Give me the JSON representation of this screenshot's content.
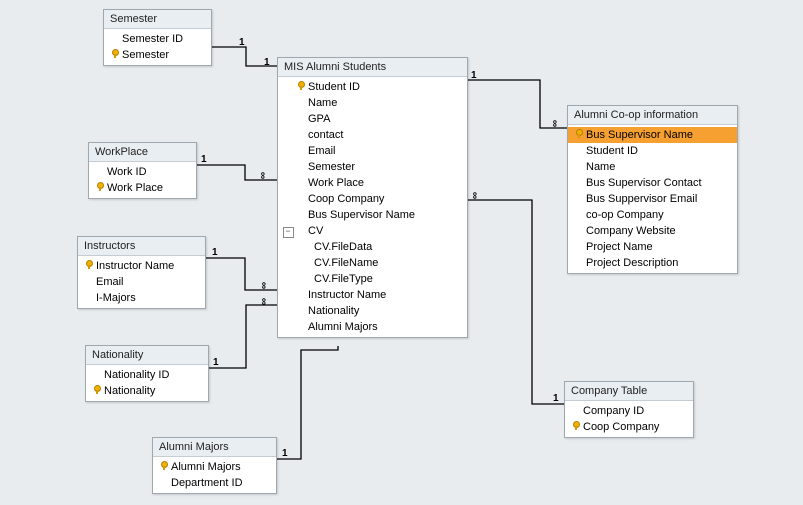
{
  "entities": {
    "semester": {
      "title": "Semester",
      "fields": [
        {
          "key": false,
          "label": "Semester ID"
        },
        {
          "key": true,
          "label": "Semester"
        }
      ]
    },
    "workplace": {
      "title": "WorkPlace",
      "fields": [
        {
          "key": false,
          "label": "Work ID"
        },
        {
          "key": true,
          "label": "Work Place"
        }
      ]
    },
    "instructors": {
      "title": "Instructors",
      "fields": [
        {
          "key": true,
          "label": "Instructor Name"
        },
        {
          "key": false,
          "label": "Email"
        },
        {
          "key": false,
          "label": "I-Majors"
        }
      ]
    },
    "nationality": {
      "title": "Nationality",
      "fields": [
        {
          "key": false,
          "label": "Nationality ID"
        },
        {
          "key": true,
          "label": "Nationality"
        }
      ]
    },
    "alumni_majors": {
      "title": "Alumni Majors",
      "fields": [
        {
          "key": true,
          "label": "Alumni Majors"
        },
        {
          "key": false,
          "label": "Department ID"
        }
      ]
    },
    "mis": {
      "title": "MIS Alumni Students",
      "fields": [
        {
          "key": true,
          "label": "Student ID"
        },
        {
          "key": false,
          "label": "Name"
        },
        {
          "key": false,
          "label": "GPA"
        },
        {
          "key": false,
          "label": "contact"
        },
        {
          "key": false,
          "label": "Email"
        },
        {
          "key": false,
          "label": "Semester"
        },
        {
          "key": false,
          "label": "Work Place"
        },
        {
          "key": false,
          "label": "Coop Company"
        },
        {
          "key": false,
          "label": "Bus Supervisor Name"
        },
        {
          "key": false,
          "label": "CV",
          "expandable": true
        },
        {
          "key": false,
          "label": "CV.FileData",
          "indent": true
        },
        {
          "key": false,
          "label": "CV.FileName",
          "indent": true
        },
        {
          "key": false,
          "label": "CV.FileType",
          "indent": true
        },
        {
          "key": false,
          "label": "Instructor Name"
        },
        {
          "key": false,
          "label": "Nationality"
        },
        {
          "key": false,
          "label": "Alumni Majors"
        }
      ]
    },
    "coop": {
      "title": "Alumni Co-op information",
      "fields": [
        {
          "key": true,
          "label": "Bus Supervisor Name",
          "selected": true
        },
        {
          "key": false,
          "label": "Student ID"
        },
        {
          "key": false,
          "label": "Name"
        },
        {
          "key": false,
          "label": "Bus Supervisor Contact"
        },
        {
          "key": false,
          "label": "Bus Suppervisor Email"
        },
        {
          "key": false,
          "label": "co-op Company"
        },
        {
          "key": false,
          "label": "Company Website"
        },
        {
          "key": false,
          "label": "Project Name"
        },
        {
          "key": false,
          "label": "Project Description"
        }
      ]
    },
    "company": {
      "title": "Company Table",
      "fields": [
        {
          "key": false,
          "label": "Company ID"
        },
        {
          "key": true,
          "label": "Coop Company"
        }
      ]
    }
  },
  "link_labels": {
    "one": "1",
    "many": "∞"
  }
}
